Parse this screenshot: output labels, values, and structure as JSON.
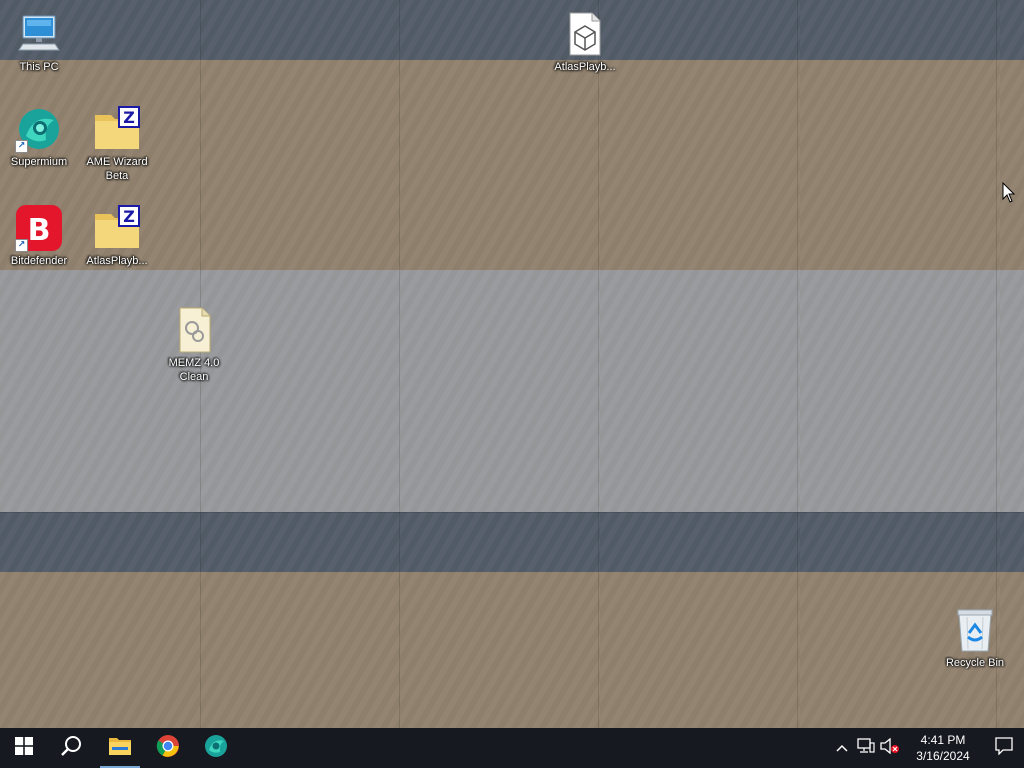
{
  "desktop": {
    "wallpaper": {
      "description": "tiled photo wallpaper (placeholder)"
    },
    "icons": [
      {
        "id": "this-pc",
        "label": "This PC",
        "icon": "computer-icon",
        "shortcut": false
      },
      {
        "id": "supermium",
        "label": "Supermium",
        "icon": "supermium-icon",
        "shortcut": true
      },
      {
        "id": "ame-wizard",
        "label": "AME Wizard\nBeta",
        "icon": "zip-folder-icon",
        "shortcut": false
      },
      {
        "id": "bitdefender",
        "label": "Bitdefender",
        "icon": "bitdefender-icon",
        "shortcut": true
      },
      {
        "id": "atlas-folder",
        "label": "AtlasPlayb...",
        "icon": "zip-folder-icon",
        "shortcut": false
      },
      {
        "id": "memz",
        "label": "MEMZ 4.0\nClean",
        "icon": "zip-archive-icon",
        "shortcut": false
      },
      {
        "id": "atlas-file",
        "label": "AtlasPlayb...",
        "icon": "playbook-file-icon",
        "shortcut": false
      },
      {
        "id": "recycle-bin",
        "label": "Recycle Bin",
        "icon": "recycle-bin-icon",
        "shortcut": false
      }
    ]
  },
  "taskbar": {
    "start": {
      "icon": "windows-logo-icon"
    },
    "search": {
      "icon": "search-icon"
    },
    "pinned": [
      {
        "id": "file-explorer",
        "icon": "folder-icon",
        "active": true
      },
      {
        "id": "chrome",
        "icon": "chrome-icon",
        "active": false
      },
      {
        "id": "supermium",
        "icon": "supermium-icon",
        "active": false
      }
    ],
    "tray": {
      "overflow_icon": "chevron-up-icon",
      "network_icon": "network-icon",
      "volume_icon": "volume-muted-icon",
      "time": "4:41 PM",
      "date": "3/16/2024",
      "notification_icon": "notification-icon"
    }
  },
  "colors": {
    "taskbar_bg": "#16191f",
    "bitdefender_red": "#e3162b",
    "folder_yellow": "#f4d77a",
    "zip_blue": "#1a1aa6"
  }
}
